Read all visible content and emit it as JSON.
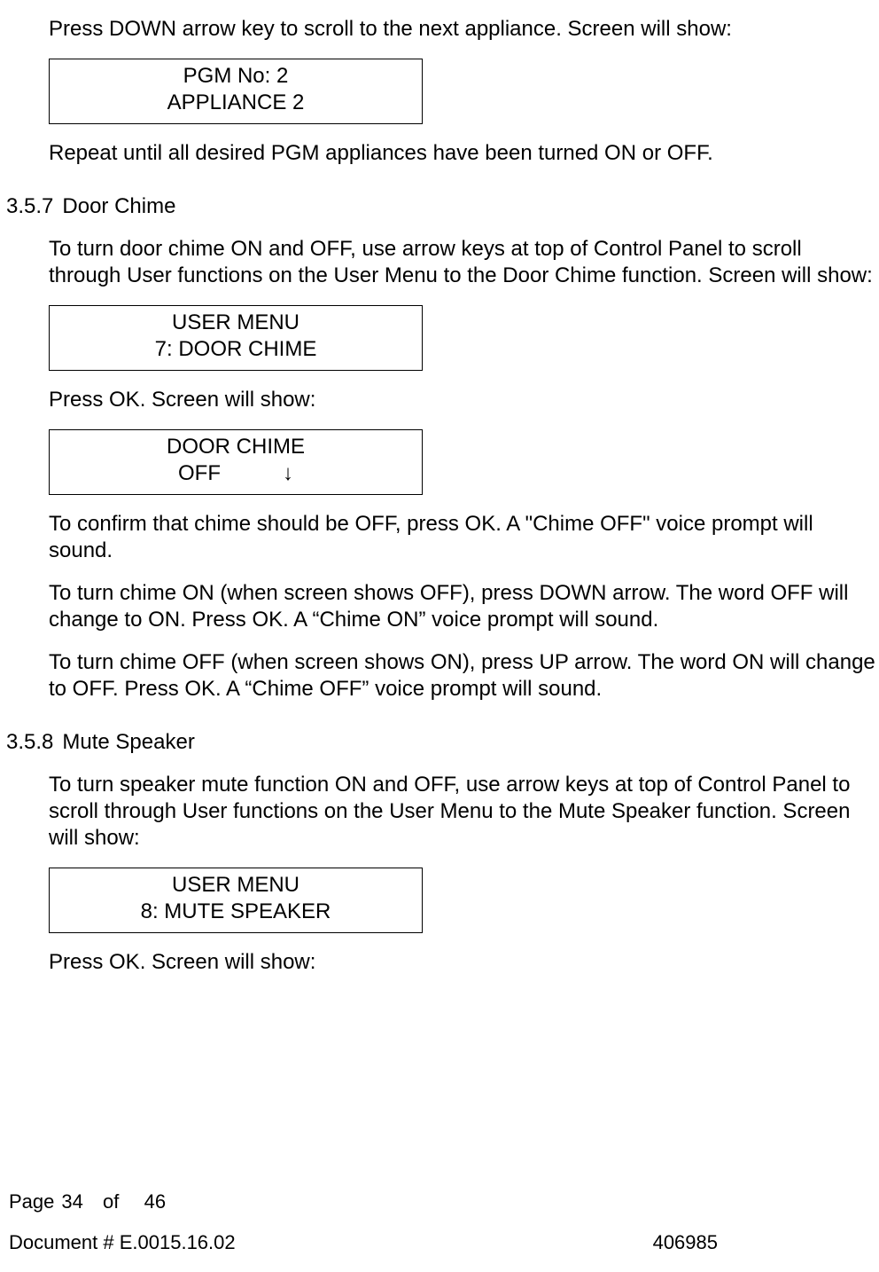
{
  "p1": "Press DOWN arrow key to scroll to the next appliance. Screen will show:",
  "lcd1": {
    "l1": "PGM No: 2",
    "l2": "APPLIANCE 2"
  },
  "p2": "Repeat until all desired PGM appliances have been turned ON or OFF.",
  "h1_num": "3.5.7",
  "h1_text": "Door Chime",
  "p3": "To turn door chime ON and OFF, use arrow keys at top of Control Panel to scroll through User functions on the User Menu to the Door Chime function. Screen will show:",
  "lcd2": {
    "l1": "USER MENU",
    "l2": "7: DOOR CHIME"
  },
  "p4": "Press OK. Screen will show:",
  "lcd3": {
    "l1": "DOOR CHIME",
    "l2a": "OFF",
    "l2b": "↓"
  },
  "p5": "To confirm that chime should be OFF, press OK. A \"Chime OFF\" voice prompt will sound.",
  "p6": "To turn chime ON (when screen shows OFF), press DOWN arrow. The word OFF will change to ON. Press OK. A “Chime ON” voice prompt will sound.",
  "p7": "To turn chime OFF (when screen shows ON), press UP arrow. The word ON will change to OFF. Press OK. A “Chime OFF” voice prompt will sound.",
  "h2_num": "3.5.8",
  "h2_text": "Mute Speaker",
  "p8": "To turn speaker mute function ON and OFF, use arrow keys at top of Control Panel to scroll through User functions on the User Menu to the Mute Speaker function. Screen will show:",
  "lcd4": {
    "l1": "USER MENU",
    "l2": "8: MUTE SPEAKER"
  },
  "p9": "Press OK. Screen will show:",
  "footer": {
    "page_word": "Page",
    "page_num": "34",
    "of_word": "of",
    "total_pages": "46",
    "doc_label": "Document # E.0015.16.02",
    "right_num": "406985"
  }
}
